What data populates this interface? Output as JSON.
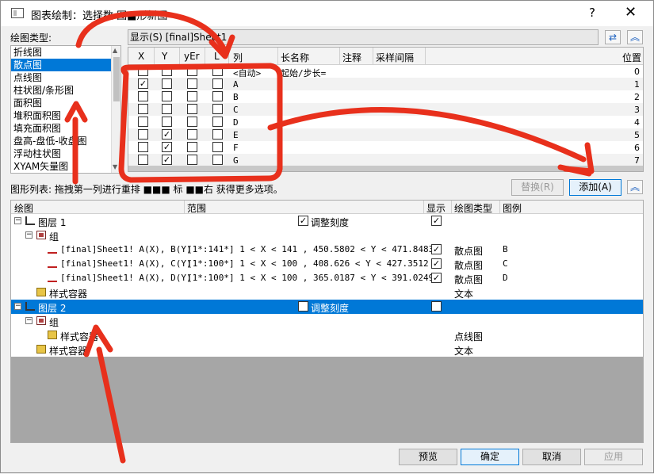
{
  "window": {
    "title": "图表绘制：选择数 图■形新图",
    "help": "?",
    "close": "✕"
  },
  "plot_types": {
    "label": "绘图类型:",
    "items": [
      "折线图",
      "散点图",
      "点线图",
      "柱状图/条形图",
      "面积图",
      "堆积面积图",
      "填充面积图",
      "盘高-盘低-收盘图",
      "浮动柱状图",
      "XYAM矢量图"
    ],
    "selected": 1
  },
  "show_bar": {
    "label": "显示(S) [final]Sheet1"
  },
  "col_grid": {
    "headers": [
      "X",
      "Y",
      "yEr",
      "L",
      "列",
      "长名称",
      "注释",
      "采样间隔",
      "位置"
    ],
    "rows": [
      {
        "col": "<自动>",
        "longname": "起始/步长=",
        "pos": "0",
        "x": false,
        "y": false
      },
      {
        "col": "A",
        "longname": "",
        "pos": "1",
        "x": true,
        "y": false
      },
      {
        "col": "B",
        "longname": "",
        "pos": "2",
        "x": false,
        "y": false
      },
      {
        "col": "C",
        "longname": "",
        "pos": "3",
        "x": false,
        "y": false
      },
      {
        "col": "D",
        "longname": "",
        "pos": "4",
        "x": false,
        "y": false
      },
      {
        "col": "E",
        "longname": "",
        "pos": "5",
        "x": false,
        "y": true
      },
      {
        "col": "F",
        "longname": "",
        "pos": "6",
        "x": false,
        "y": true
      },
      {
        "col": "G",
        "longname": "",
        "pos": "7",
        "x": false,
        "y": true
      }
    ]
  },
  "plot_list": {
    "label": "图形列表: 拖拽第一列进行重排 ■■■ 标 ■■右 获得更多选项。"
  },
  "buttons": {
    "replace": "替换(R)",
    "add": "添加(A)",
    "preview": "预览",
    "ok": "确定",
    "cancel": "取消",
    "apply": "应用"
  },
  "tree": {
    "headers": [
      "绘图",
      "范围",
      "显示",
      "绘图类型",
      "图例"
    ],
    "rows": [
      {
        "text": "图层 1",
        "range": "调整刻度",
        "show": true,
        "type": "",
        "legend": "",
        "level": 0,
        "icon": "layer-icon",
        "exp": "−"
      },
      {
        "text": "组",
        "range": "",
        "show": null,
        "type": "",
        "legend": "",
        "level": 1,
        "icon": "group-icon",
        "exp": "−"
      },
      {
        "text": "[final]Sheet1! A(X), B(Y)",
        "range": "[1*:141*]   1 < X < 141 , 450.5802 < Y < 471.8483",
        "show": true,
        "type": "散点图",
        "legend": "B",
        "level": 2,
        "icon": "scatter-curve-icon",
        "exp": ""
      },
      {
        "text": "[final]Sheet1! A(X), C(Y)",
        "range": "[1*:100*]   1 < X < 100 , 408.626 < Y < 427.3512",
        "show": true,
        "type": "散点图",
        "legend": "C",
        "level": 2,
        "icon": "scatter-curve-icon",
        "exp": ""
      },
      {
        "text": "[final]Sheet1! A(X), D(Y)",
        "range": "[1*:100*]   1 < X < 100 , 365.0187 < Y < 391.0249",
        "show": true,
        "type": "散点图",
        "legend": "D",
        "level": 2,
        "icon": "scatter-curve-icon",
        "exp": ""
      },
      {
        "text": "样式容器",
        "range": "",
        "show": null,
        "type": "文本",
        "legend": "",
        "level": 1,
        "icon": "folder-icon",
        "exp": ""
      },
      {
        "text": "图层 2",
        "range": "调整刻度",
        "show": true,
        "type": "",
        "legend": "",
        "level": 0,
        "icon": "layer-icon",
        "exp": "−",
        "selected": true
      },
      {
        "text": "组",
        "range": "",
        "show": null,
        "type": "",
        "legend": "",
        "level": 1,
        "icon": "group-icon",
        "exp": "−"
      },
      {
        "text": "样式容器",
        "range": "",
        "show": null,
        "type": "点线图",
        "legend": "",
        "level": 2,
        "icon": "folder-icon",
        "exp": ""
      },
      {
        "text": "样式容器",
        "range": "",
        "show": null,
        "type": "文本",
        "legend": "",
        "level": 1,
        "icon": "folder-icon",
        "exp": ""
      }
    ]
  },
  "annotation_color": "#e8301c"
}
